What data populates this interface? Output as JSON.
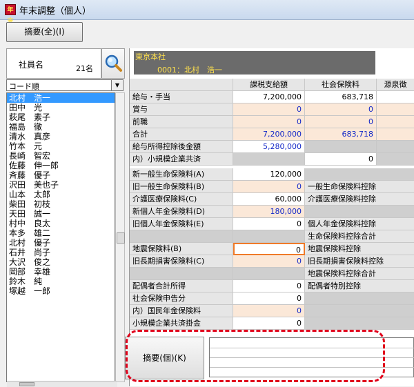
{
  "window": {
    "title": "年末調整（個人）",
    "icon_text": "年末"
  },
  "toolbar": {
    "summary_all": "摘要(全)(I)"
  },
  "employee_panel": {
    "label": "社員名",
    "count": "21名",
    "sort_value": "コード順",
    "employees": [
      "北村　浩一",
      "田中　光",
      "萩尾　素子",
      "福島　徹",
      "清水　真彦",
      "竹本　元",
      "長崎　智宏",
      "佐藤　伸一郎",
      "斉藤　優子",
      "沢田　美也子",
      "山本　太郎",
      "柴田　初枝",
      "天田　誠一",
      "村中　良太",
      "本多　雄二",
      "北村　優子",
      "石井　尚子",
      "大沢　俊之",
      "岡部　幸雄",
      "鈴木　純",
      "塚越　一郎"
    ]
  },
  "header": {
    "office": "東京本社",
    "employee": "0001：北村　浩一"
  },
  "grid": {
    "columns": [
      "課税支給額",
      "社会保険料",
      "源泉徴"
    ],
    "income_rows": [
      {
        "label": "給与・手当",
        "taxable": "7,200,000",
        "social": "683,718"
      },
      {
        "label": "賞与",
        "taxable": "0",
        "social": "0"
      },
      {
        "label": "前職",
        "taxable": "0",
        "social": "0"
      },
      {
        "label": "合計",
        "taxable": "7,200,000",
        "social": "683,718"
      },
      {
        "label": "給与所得控除後金額",
        "taxable": "5,280,000",
        "social": ""
      },
      {
        "label": "内）小規模企業共済",
        "taxable": "",
        "social": "0"
      }
    ],
    "insurance_rows": [
      {
        "label": "新一般生命保険料(A)",
        "value": "120,000",
        "right": ""
      },
      {
        "label": "旧一般生命保険料(B)",
        "value": "0",
        "right": "一般生命保険料控除"
      },
      {
        "label": "介護医療保険料(C)",
        "value": "60,000",
        "right": "介護医療保険料控除"
      },
      {
        "label": "新個人年金保険料(D)",
        "value": "180,000",
        "right": ""
      },
      {
        "label": "旧個人年金保険料(E)",
        "value": "0",
        "right": "個人年金保険料控除"
      },
      {
        "label": "",
        "value": "",
        "right": "生命保険料控除合計"
      },
      {
        "label": "地震保険料(B)",
        "value": "0",
        "right": "地震保険料控除"
      },
      {
        "label": "旧長期損害保険料(C)",
        "value": "0",
        "right": "旧長期損害保険料控除"
      },
      {
        "label": "",
        "value": "",
        "right": "地震保険料控除合計"
      },
      {
        "label": "配偶者合計所得",
        "value": "0",
        "right": "配偶者特別控除"
      },
      {
        "label": "社会保険申告分",
        "value": "0",
        "right": ""
      },
      {
        "label": "内）国民年金保険料",
        "value": "0",
        "right": ""
      },
      {
        "label": "小規模企業共済掛金",
        "value": "0",
        "right": ""
      }
    ]
  },
  "footer": {
    "summary_individual": "摘要(個)(K)"
  },
  "colors": {
    "accent_yellow": "#ffe14d",
    "value_blue": "#1428c8",
    "highlight_red": "#e0001a",
    "selection": "#3399ff"
  }
}
